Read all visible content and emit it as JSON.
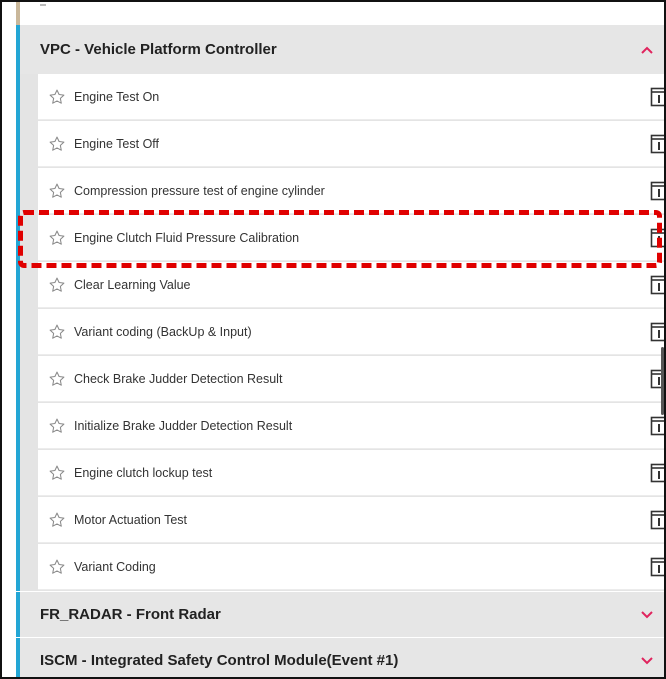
{
  "groups": [
    {
      "title": "VPC - Vehicle Platform Controller",
      "expanded": true,
      "chevron": "chevron-up-icon"
    },
    {
      "title": "FR_RADAR - Front Radar",
      "expanded": false,
      "chevron": "chevron-down-icon"
    },
    {
      "title": "ISCM - Integrated Safety Control Module(Event #1)",
      "expanded": false,
      "chevron": "chevron-down-icon"
    }
  ],
  "items": [
    {
      "label": "Engine Test On"
    },
    {
      "label": "Engine Test Off"
    },
    {
      "label": "Compression pressure test of engine cylinder"
    },
    {
      "label": "Engine Clutch Fluid Pressure Calibration",
      "highlighted": true
    },
    {
      "label": "Clear Learning Value"
    },
    {
      "label": "Variant coding (BackUp & Input)"
    },
    {
      "label": "Check Brake Judder Detection Result"
    },
    {
      "label": "Initialize Brake Judder Detection Result"
    },
    {
      "label": "Engine clutch lockup test"
    },
    {
      "label": "Motor Actuation Test"
    },
    {
      "label": "Variant Coding"
    }
  ],
  "colors": {
    "accent": "#23a6d5",
    "chevron": "#e0245e",
    "highlight": "#e00000",
    "header_bg": "#e6e6e6"
  },
  "icons": {
    "favorite": "star-outline-icon",
    "info": "info-document-icon"
  }
}
